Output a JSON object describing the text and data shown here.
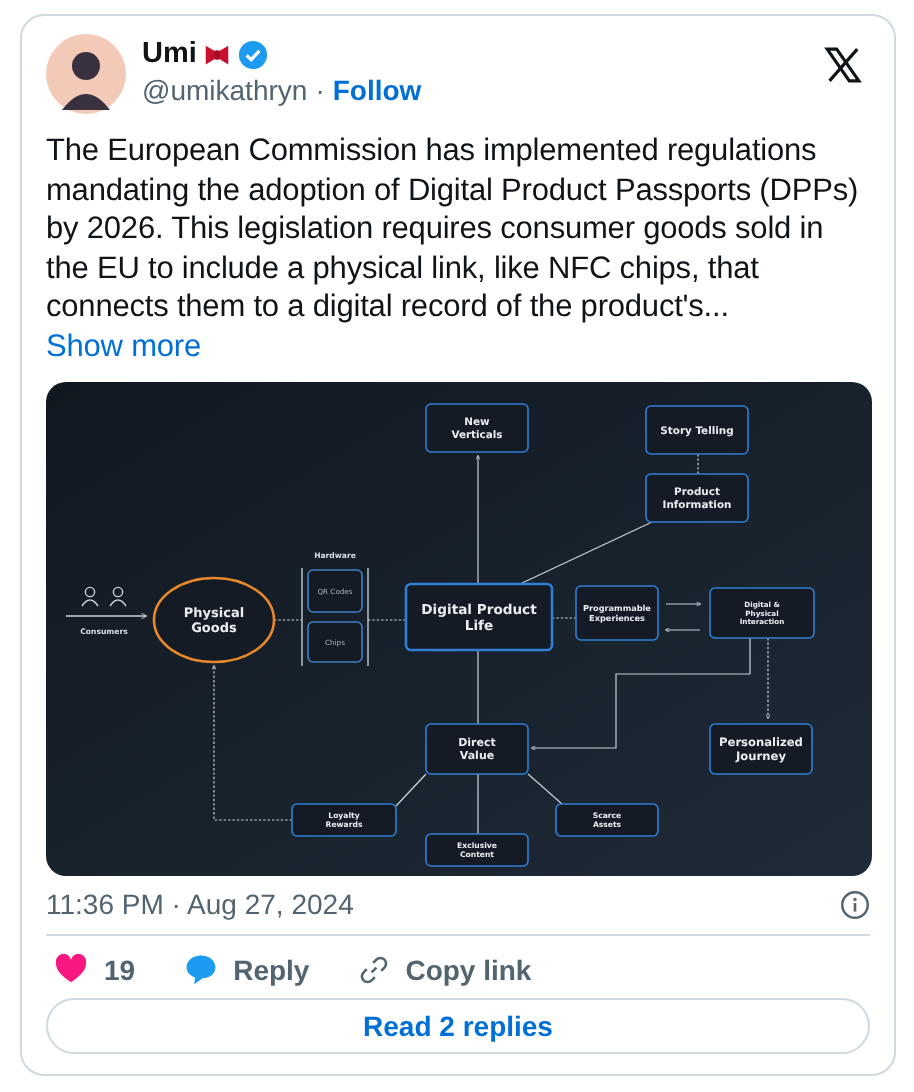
{
  "author": {
    "name": "Umi",
    "handle": "@umikathryn",
    "separator": "·",
    "follow": "Follow",
    "verified": true
  },
  "text": "The European Commission has implemented regulations mandating the adoption of Digital Product Passports (DPPs) by 2026. This legislation requires consumer goods sold in the EU to include a physical link, like NFC chips, that connects them to a digital record of the product's...",
  "show_more": "Show more",
  "diagram": {
    "consumers_label": "Consumers",
    "hardware_label": "Hardware",
    "nodes": [
      {
        "kind": "box",
        "lines": [
          "New",
          "Verticals"
        ]
      },
      {
        "kind": "box",
        "lines": [
          "Story Telling"
        ]
      },
      {
        "kind": "box",
        "lines": [
          "Product",
          "Information"
        ]
      },
      {
        "kind": "oval",
        "lines": [
          "Physical",
          "Goods"
        ]
      },
      {
        "kind": "slot",
        "lines": [
          "QR Codes"
        ]
      },
      {
        "kind": "slot",
        "lines": [
          "Chips"
        ]
      },
      {
        "kind": "main",
        "lines": [
          "Digital Product",
          "Life"
        ]
      },
      {
        "kind": "box",
        "lines": [
          "Programmable",
          "Experiences"
        ]
      },
      {
        "kind": "box",
        "lines": [
          "Digital &",
          "Physical",
          "Interaction"
        ]
      },
      {
        "kind": "box",
        "lines": [
          "Direct",
          "Value"
        ]
      },
      {
        "kind": "box",
        "lines": [
          "Personalized",
          "Journey"
        ]
      },
      {
        "kind": "box",
        "lines": [
          "Loyalty",
          "Rewards"
        ]
      },
      {
        "kind": "box",
        "lines": [
          "Scarce",
          "Assets"
        ]
      },
      {
        "kind": "box",
        "lines": [
          "Exclusive",
          "Content"
        ]
      }
    ]
  },
  "timestamp": "11:36 PM · Aug 27, 2024",
  "actions": {
    "likes": "19",
    "reply": "Reply",
    "copy_link": "Copy link"
  },
  "read_replies": "Read 2 replies"
}
